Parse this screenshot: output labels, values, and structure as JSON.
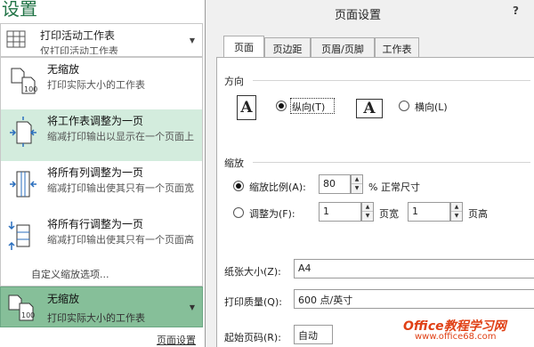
{
  "left_panel": {
    "title": "设置",
    "print_scope": {
      "title": "打印活动工作表",
      "desc": "仅打印活动工作表"
    },
    "scaling_options": [
      {
        "title": "无缩放",
        "desc": "打印实际大小的工作表",
        "selected": false
      },
      {
        "title": "将工作表调整为一页",
        "desc": "缩减打印输出以显示在一个页面上",
        "selected": true
      },
      {
        "title": "将所有列调整为一页",
        "desc": "缩减打印输出使其只有一个页面宽",
        "selected": false
      },
      {
        "title": "将所有行调整为一页",
        "desc": "缩减打印输出使其只有一个页面高",
        "selected": false
      }
    ],
    "custom_scaling": "自定义缩放选项...",
    "current_scaling": {
      "title": "无缩放",
      "desc": "打印实际大小的工作表"
    },
    "page_setup_link": "页面设置",
    "accent_color": "#217346",
    "selected_bg": "#d3ecdd",
    "dropdown_bg": "#86bf99"
  },
  "dialog": {
    "title": "页面设置",
    "help": "?",
    "tabs": [
      "页面",
      "页边距",
      "页眉/页脚",
      "工作表"
    ],
    "active_tab": "页面",
    "orientation": {
      "label": "方向",
      "portrait": "纵向(T)",
      "landscape": "横向(L)",
      "selected": "portrait",
      "icon_letter": "A"
    },
    "scaling": {
      "label": "缩放",
      "adjust_to_label": "缩放比例(A):",
      "adjust_to_value": "80",
      "adjust_to_suffix": "% 正常尺寸",
      "fit_to_label": "调整为(F):",
      "pages_wide_value": "1",
      "pages_wide_label": "页宽",
      "pages_tall_value": "1",
      "pages_tall_label": "页高",
      "selected": "adjust"
    },
    "paper_size_label": "纸张大小(Z):",
    "paper_size_value": "A4",
    "print_quality_label": "打印质量(Q):",
    "print_quality_value": "600 点/英寸",
    "first_page_label": "起始页码(R):",
    "first_page_value": "自动"
  },
  "watermark": {
    "line1": "Office教程学习网",
    "line2": "www.office68.com"
  }
}
